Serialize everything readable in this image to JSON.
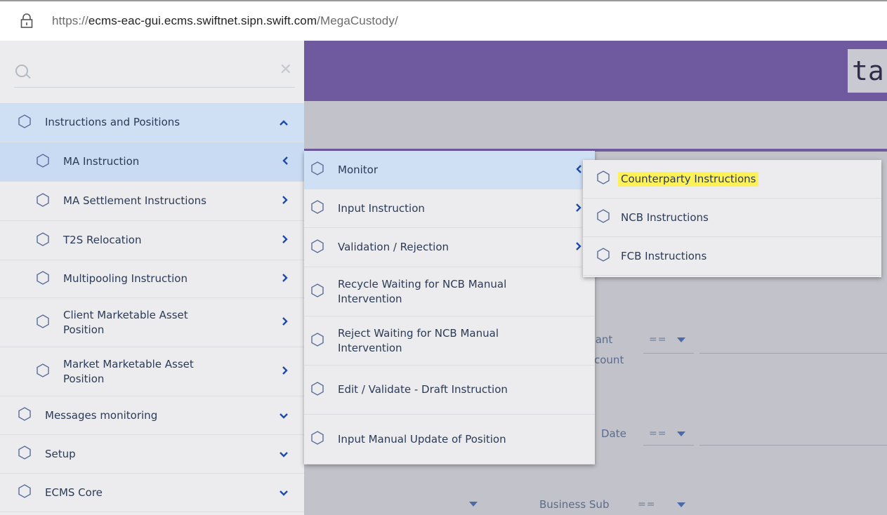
{
  "browser": {
    "url_prefix": "https://",
    "url_host": "ecms-eac-gui.ecms.swiftnet.sipn.swift.com",
    "url_path": "/MegaCustody/"
  },
  "header": {
    "brand_fragment": "ta"
  },
  "search": {
    "placeholder": "",
    "value": ""
  },
  "sidebar": {
    "items": [
      {
        "label": "Instructions and Positions",
        "chevron": "^"
      },
      {
        "label": "MA Instruction",
        "chevron": "<"
      },
      {
        "label": "MA Settlement Instructions",
        "chevron": ">"
      },
      {
        "label": "T2S Relocation",
        "chevron": ">"
      },
      {
        "label": "Multipooling Instruction",
        "chevron": ">"
      },
      {
        "label": "Client Marketable Asset Position",
        "chevron": ">"
      },
      {
        "label": "Market Marketable Asset Position",
        "chevron": ">"
      },
      {
        "label": "Messages monitoring",
        "chevron": "v"
      },
      {
        "label": "Setup",
        "chevron": "v"
      },
      {
        "label": "ECMS Core",
        "chevron": "v"
      }
    ]
  },
  "submenu": {
    "items": [
      {
        "label": "Monitor",
        "chevron": "<"
      },
      {
        "label": "Input Instruction",
        "chevron": ">"
      },
      {
        "label": "Validation / Rejection",
        "chevron": ">"
      },
      {
        "label": "Recycle Waiting for NCB Manual Intervention",
        "chevron": ""
      },
      {
        "label": "Reject Waiting for NCB Manual Intervention",
        "chevron": ""
      },
      {
        "label": "Edit / Validate - Draft Instruction",
        "chevron": ""
      },
      {
        "label": "Input Manual Update of Position",
        "chevron": ""
      }
    ]
  },
  "submenu2": {
    "items": [
      {
        "label": "Counterparty Instructions"
      },
      {
        "label": "NCB Instructions"
      },
      {
        "label": "FCB Instructions"
      }
    ]
  },
  "background_form": {
    "label1a": "ipant",
    "label1b": "count",
    "label2": "Date",
    "label3": "Business Sub",
    "operator": "=="
  },
  "colors": {
    "header": "#6f5aa0",
    "active_item": "#cfe0f5",
    "highlight": "#fff15a",
    "chevron": "#1f4aa8"
  }
}
